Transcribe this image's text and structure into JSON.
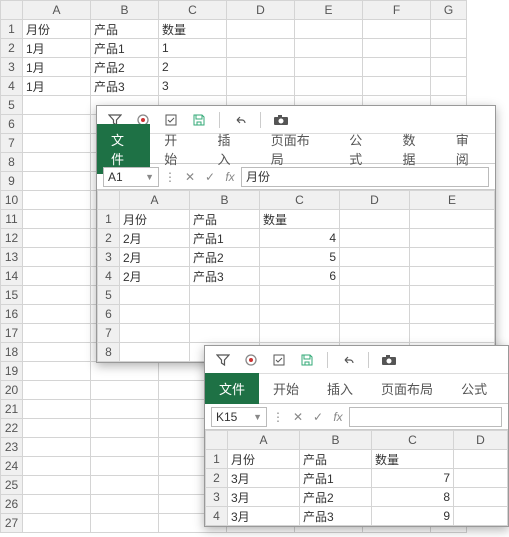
{
  "main_sheet": {
    "columns": [
      "A",
      "B",
      "C",
      "D",
      "E",
      "F",
      "G"
    ],
    "rows": [
      "1",
      "2",
      "3",
      "4",
      "5",
      "6",
      "7",
      "8",
      "9",
      "10",
      "11",
      "12",
      "13",
      "14",
      "15",
      "16",
      "17",
      "18",
      "19",
      "20",
      "21",
      "22",
      "23",
      "24",
      "25",
      "26",
      "27"
    ],
    "headers": {
      "a": "月份",
      "b": "产品",
      "c": "数量"
    },
    "data": [
      {
        "a": "1月",
        "b": "产品1",
        "c": "1"
      },
      {
        "a": "1月",
        "b": "产品2",
        "c": "2"
      },
      {
        "a": "1月",
        "b": "产品3",
        "c": "3"
      }
    ]
  },
  "window1": {
    "ribbon": {
      "file": "文件",
      "home": "开始",
      "insert": "插入",
      "layout": "页面布局",
      "formula": "公式",
      "data": "数据",
      "review": "审阅"
    },
    "namebox": "A1",
    "formula_value": "月份",
    "sheet": {
      "columns": [
        "A",
        "B",
        "C",
        "D",
        "E"
      ],
      "rows": [
        "1",
        "2",
        "3",
        "4",
        "5",
        "6",
        "7",
        "8"
      ],
      "headers": {
        "a": "月份",
        "b": "产品",
        "c": "数量"
      },
      "data": [
        {
          "a": "2月",
          "b": "产品1",
          "c": "4"
        },
        {
          "a": "2月",
          "b": "产品2",
          "c": "5"
        },
        {
          "a": "2月",
          "b": "产品3",
          "c": "6"
        }
      ]
    }
  },
  "window2": {
    "ribbon": {
      "file": "文件",
      "home": "开始",
      "insert": "插入",
      "layout": "页面布局",
      "formula": "公式"
    },
    "namebox": "K15",
    "formula_value": "",
    "sheet": {
      "columns": [
        "A",
        "B",
        "C",
        "D"
      ],
      "rows": [
        "1",
        "2",
        "3",
        "4"
      ],
      "headers": {
        "a": "月份",
        "b": "产品",
        "c": "数量"
      },
      "data": [
        {
          "a": "3月",
          "b": "产品1",
          "c": "7"
        },
        {
          "a": "3月",
          "b": "产品2",
          "c": "8"
        },
        {
          "a": "3月",
          "b": "产品3",
          "c": "9"
        }
      ]
    }
  },
  "fx_label": "fx"
}
